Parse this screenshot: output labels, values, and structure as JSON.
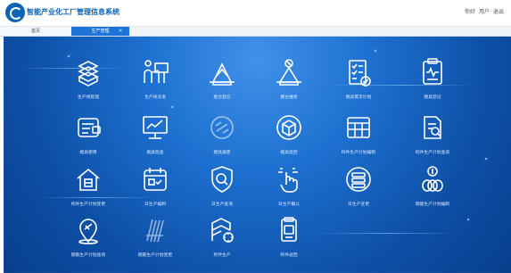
{
  "app": {
    "title": "智能产业化工厂管理信息系统",
    "user_area": [
      "你好",
      "用户",
      "退出"
    ]
  },
  "tabs": [
    {
      "label": "首页",
      "active": false
    },
    {
      "label": "生产管理",
      "active": true
    }
  ],
  "modules": [
    {
      "label": "生产线管理",
      "icon": "pallet-stack-icon"
    },
    {
      "label": "生产线派发",
      "icon": "presentation-icon"
    },
    {
      "label": "模台登记",
      "icon": "mold-platform-icon"
    },
    {
      "label": "模台维修",
      "icon": "mold-platform-edit-icon"
    },
    {
      "label": "模具需求计划",
      "icon": "checklist-icon"
    },
    {
      "label": "模具登记",
      "icon": "clipboard-chart-icon"
    },
    {
      "label": "模具使用",
      "icon": "scanner-card-icon"
    },
    {
      "label": "模具检查",
      "icon": "monitor-chart-icon"
    },
    {
      "label": "模具报废",
      "icon": "circle-badge-icon"
    },
    {
      "label": "模具退回",
      "icon": "open-box-icon"
    },
    {
      "label": "构件生产计划编制",
      "icon": "table-grid-icon"
    },
    {
      "label": "构件生产计划查询",
      "icon": "document-search-icon"
    },
    {
      "label": "构件生产计划变更",
      "icon": "house-scan-icon"
    },
    {
      "label": "日生产编制",
      "icon": "calendar-check-icon"
    },
    {
      "label": "日生产查询",
      "icon": "shield-search-icon"
    },
    {
      "label": "日生产确认",
      "icon": "finger-touch-icon"
    },
    {
      "label": "日生产变更",
      "icon": "database-list-icon"
    },
    {
      "label": "钢筋生产计划编制",
      "icon": "rebar-coil-icon"
    },
    {
      "label": "钢筋生产计划查询",
      "icon": "location-pin-icon"
    },
    {
      "label": "钢筋生产计划变更",
      "icon": "rebar-bundle-icon"
    },
    {
      "label": "构件生产",
      "icon": "building-gear-icon"
    },
    {
      "label": "构件返回",
      "icon": "document-card-icon"
    }
  ],
  "colors": {
    "brand": "#0a63b8",
    "tab_active": "#1d74d6",
    "background_center": "#3f91ea",
    "background_edge": "#083f8c"
  }
}
